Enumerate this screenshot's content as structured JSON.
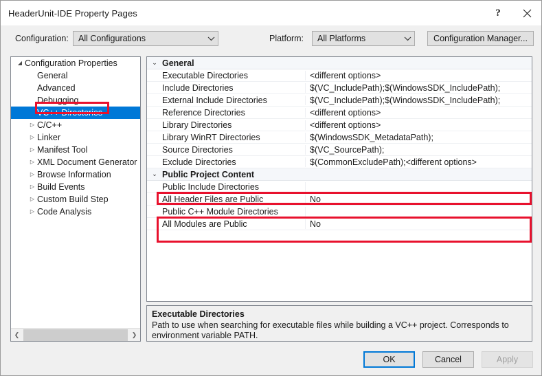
{
  "window": {
    "title": "HeaderUnit-IDE Property Pages",
    "help_glyph": "?",
    "close_icon_name": "close-icon"
  },
  "configbar": {
    "configuration_label": "Configuration:",
    "configuration_value": "All Configurations",
    "platform_label": "Platform:",
    "platform_value": "All Platforms",
    "configuration_manager_label": "Configuration Manager...",
    "dropdown_arrow": "⌄"
  },
  "tree": {
    "selected": "VC++ Directories",
    "twisty_expanded": "◢",
    "twisty_collapsed": "▷",
    "items": [
      {
        "label": "Configuration Properties",
        "depth": 0,
        "twisty": "expanded",
        "selected": false
      },
      {
        "label": "General",
        "depth": 1,
        "twisty": "none",
        "selected": false
      },
      {
        "label": "Advanced",
        "depth": 1,
        "twisty": "none",
        "selected": false
      },
      {
        "label": "Debugging",
        "depth": 1,
        "twisty": "none",
        "selected": false
      },
      {
        "label": "VC++ Directories",
        "depth": 1,
        "twisty": "none",
        "selected": true
      },
      {
        "label": "C/C++",
        "depth": 1,
        "twisty": "collapsed",
        "selected": false
      },
      {
        "label": "Linker",
        "depth": 1,
        "twisty": "collapsed",
        "selected": false
      },
      {
        "label": "Manifest Tool",
        "depth": 1,
        "twisty": "collapsed",
        "selected": false
      },
      {
        "label": "XML Document Generator",
        "depth": 1,
        "twisty": "collapsed",
        "selected": false
      },
      {
        "label": "Browse Information",
        "depth": 1,
        "twisty": "collapsed",
        "selected": false
      },
      {
        "label": "Build Events",
        "depth": 1,
        "twisty": "collapsed",
        "selected": false
      },
      {
        "label": "Custom Build Step",
        "depth": 1,
        "twisty": "collapsed",
        "selected": false
      },
      {
        "label": "Code Analysis",
        "depth": 1,
        "twisty": "collapsed",
        "selected": false
      }
    ],
    "scrollbar": {
      "left_arrow": "❮",
      "right_arrow": "❯"
    }
  },
  "grid": {
    "group_twisty": "⌄",
    "rows": [
      {
        "kind": "group",
        "name": "General",
        "value": ""
      },
      {
        "kind": "prop",
        "name": "Executable Directories",
        "value": "<different options>"
      },
      {
        "kind": "prop",
        "name": "Include Directories",
        "value": "$(VC_IncludePath);$(WindowsSDK_IncludePath);"
      },
      {
        "kind": "prop",
        "name": "External Include Directories",
        "value": "$(VC_IncludePath);$(WindowsSDK_IncludePath);"
      },
      {
        "kind": "prop",
        "name": "Reference Directories",
        "value": "<different options>"
      },
      {
        "kind": "prop",
        "name": "Library Directories",
        "value": "<different options>"
      },
      {
        "kind": "prop",
        "name": "Library WinRT Directories",
        "value": "$(WindowsSDK_MetadataPath);"
      },
      {
        "kind": "prop",
        "name": "Source Directories",
        "value": "$(VC_SourcePath);"
      },
      {
        "kind": "prop",
        "name": "Exclude Directories",
        "value": "$(CommonExcludePath);<different options>"
      },
      {
        "kind": "group",
        "name": "Public Project Content",
        "value": ""
      },
      {
        "kind": "prop",
        "name": "Public Include Directories",
        "value": ""
      },
      {
        "kind": "prop",
        "name": "All Header Files are Public",
        "value": "No"
      },
      {
        "kind": "prop",
        "name": "Public C++ Module Directories",
        "value": ""
      },
      {
        "kind": "prop",
        "name": "All Modules are Public",
        "value": "No"
      }
    ]
  },
  "description": {
    "title": "Executable Directories",
    "body": "Path to use when searching for executable files while building a VC++ project.  Corresponds to environment variable PATH."
  },
  "footer": {
    "ok_label": "OK",
    "cancel_label": "Cancel",
    "apply_label": "Apply"
  },
  "colors": {
    "accent": "#0078d7",
    "annotation": "#e8112d",
    "dialog_bg": "#f0f0f0"
  }
}
